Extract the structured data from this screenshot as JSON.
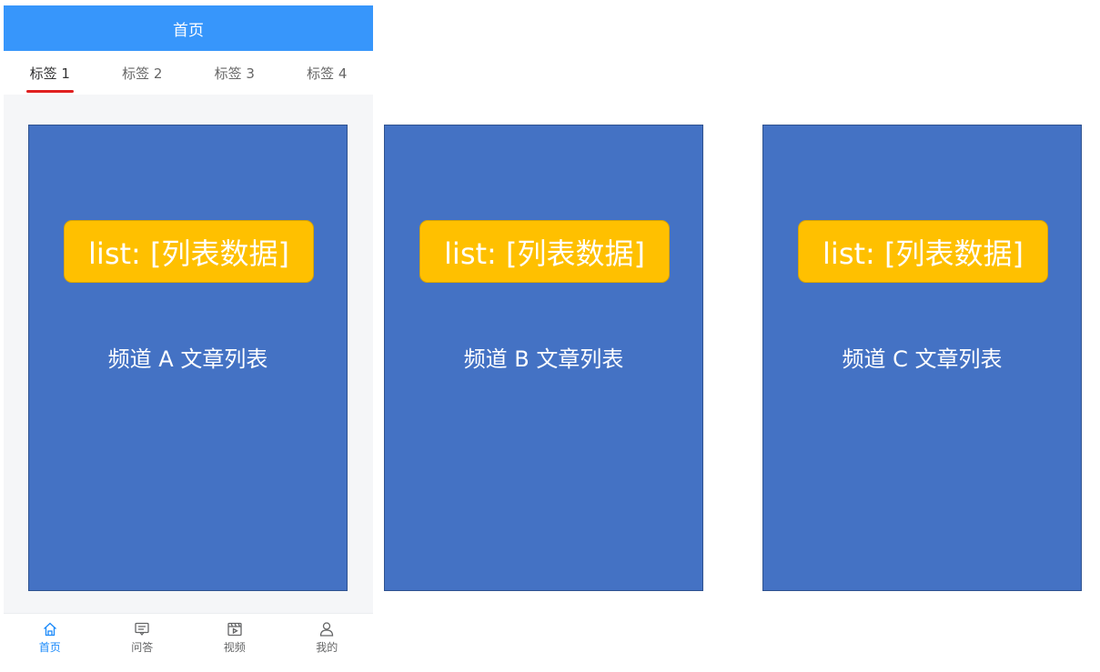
{
  "navbar": {
    "title": "首页"
  },
  "tabs": [
    {
      "label": "标签 1",
      "active": true
    },
    {
      "label": "标签 2",
      "active": false
    },
    {
      "label": "标签 3",
      "active": false
    },
    {
      "label": "标签 4",
      "active": false
    }
  ],
  "panels": [
    {
      "badge": "list: [列表数据]",
      "title": "频道 A 文章列表"
    },
    {
      "badge": "list: [列表数据]",
      "title": "频道 B 文章列表"
    },
    {
      "badge": "list: [列表数据]",
      "title": "频道 C 文章列表"
    }
  ],
  "tabbar": [
    {
      "label": "首页",
      "icon": "home-icon",
      "active": true
    },
    {
      "label": "问答",
      "icon": "chat-icon",
      "active": false
    },
    {
      "label": "视频",
      "icon": "video-icon",
      "active": false
    },
    {
      "label": "我的",
      "icon": "user-icon",
      "active": false
    }
  ],
  "colors": {
    "navbar": "#3796fb",
    "tab_underline": "#e02020",
    "panel": "#4472c4",
    "badge": "#ffc000",
    "tabbar_active": "#1989fa"
  }
}
